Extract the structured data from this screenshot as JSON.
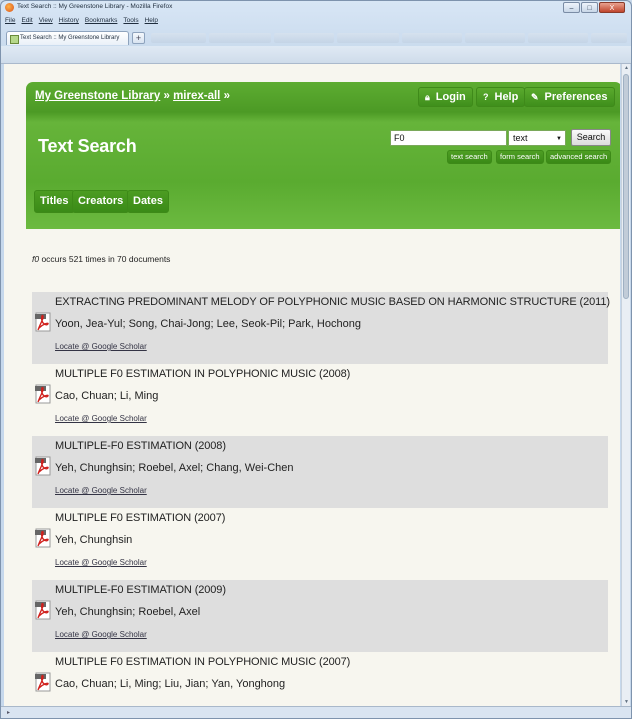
{
  "browser": {
    "window_title": "Text Search :: My Greenstone Library - Mozilla Firefox",
    "menu": [
      "File",
      "Edit",
      "View",
      "History",
      "Bookmarks",
      "Tools",
      "Help"
    ],
    "active_tab": "Text Search :: My Greenstone Library",
    "new_tab_label": "+",
    "window_buttons": {
      "minimize": "–",
      "maximize": "□",
      "close": "X"
    }
  },
  "header": {
    "breadcrumb_library": "My Greenstone Library",
    "breadcrumb_collection": "mirex-all",
    "breadcrumb_sep1": " » ",
    "breadcrumb_sep2": " »",
    "login_label": "Login",
    "help_label": "Help",
    "preferences_label": "Preferences",
    "page_title": "Text Search"
  },
  "search": {
    "query": "F0",
    "index": "text",
    "submit_label": "Search",
    "text_search_link": "text search",
    "form_search_link": "form search",
    "advanced_search_link": "advanced search"
  },
  "browse_tabs": [
    "Titles",
    "Creators",
    "Dates"
  ],
  "summary": {
    "term": "f0",
    "rest": " occurs 521 times in 70 documents"
  },
  "results": [
    {
      "title": "EXTRACTING PREDOMINANT MELODY OF POLYPHONIC MUSIC BASED ON HARMONIC STRUCTURE (2011)",
      "authors": "Yoon, Jea-Yul; Song, Chai-Jong; Lee, Seok-Pil; Park, Hochong",
      "locate": "Locate @ Google Scholar"
    },
    {
      "title": "MULTIPLE F0 ESTIMATION IN POLYPHONIC MUSIC (2008)",
      "authors": "Cao, Chuan; Li, Ming",
      "locate": "Locate @ Google Scholar"
    },
    {
      "title": "MULTIPLE-F0 ESTIMATION (2008)",
      "authors": "Yeh, Chunghsin; Roebel, Axel; Chang, Wei-Chen",
      "locate": "Locate @ Google Scholar"
    },
    {
      "title": "MULTIPLE F0 ESTIMATION (2007)",
      "authors": "Yeh, Chunghsin",
      "locate": "Locate @ Google Scholar"
    },
    {
      "title": "MULTIPLE-F0 ESTIMATION (2009)",
      "authors": "Yeh, Chunghsin; Roebel, Axel",
      "locate": "Locate @ Google Scholar"
    },
    {
      "title": "MULTIPLE F0 ESTIMATION IN POLYPHONIC MUSIC (2007)",
      "authors": "Cao, Chuan; Li, Ming; Liu, Jian; Yan, Yonghong",
      "locate": ""
    }
  ],
  "colors": {
    "header_green": "#5aab30",
    "result_shade": "#dedede",
    "page_bg": "#f7f6ef"
  }
}
